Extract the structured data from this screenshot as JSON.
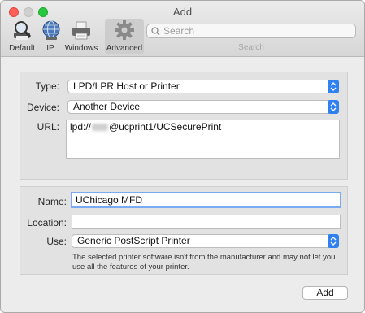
{
  "window": {
    "title": "Add"
  },
  "toolbar": {
    "items": [
      {
        "label": "Default",
        "icon": "magnifier-printer-icon"
      },
      {
        "label": "IP",
        "icon": "globe-icon"
      },
      {
        "label": "Windows",
        "icon": "windows-printer-icon"
      },
      {
        "label": "Advanced",
        "icon": "gear-icon",
        "selected": true
      }
    ],
    "search": {
      "placeholder": "Search",
      "caption": "Search"
    }
  },
  "connection": {
    "type": {
      "label": "Type:",
      "value": "LPD/LPR Host or Printer"
    },
    "device": {
      "label": "Device:",
      "value": "Another Device"
    },
    "url": {
      "label": "URL:",
      "prefix": "lpd://",
      "suffix": "@ucprint1/UCSecurePrint"
    }
  },
  "details": {
    "name": {
      "label": "Name:",
      "value": "UChicago MFD"
    },
    "location": {
      "label": "Location:",
      "value": ""
    },
    "use": {
      "label": "Use:",
      "value": "Generic PostScript Printer"
    },
    "note": "The selected printer software isn't from the manufacturer and may not let you use all the features of your printer."
  },
  "actions": {
    "add_label": "Add"
  },
  "colors": {
    "accent": "#2f80f0",
    "focus_ring": "#7aaaf2",
    "close": "#fe5f57",
    "maximize": "#28c840"
  }
}
